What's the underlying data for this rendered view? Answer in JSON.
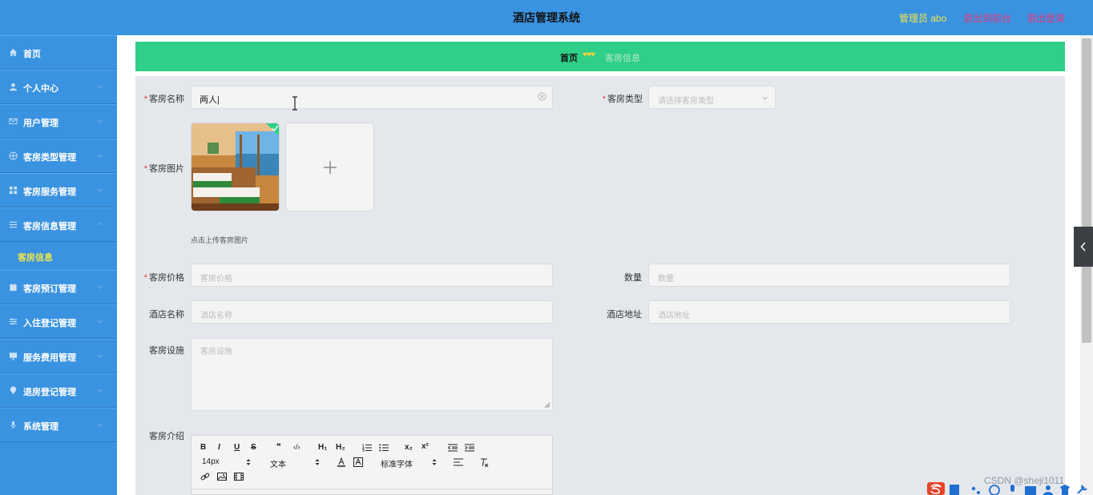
{
  "header": {
    "title": "酒店管理系统",
    "admin": "管理员 abo",
    "front_link": "退出到前台",
    "logout_link": "退出登录"
  },
  "sidebar": {
    "items": [
      {
        "label": "首页",
        "icon": "home-icon"
      },
      {
        "label": "个人中心",
        "icon": "user-icon"
      },
      {
        "label": "用户管理",
        "icon": "mail-icon"
      },
      {
        "label": "客房类型管理",
        "icon": "globe-icon"
      },
      {
        "label": "客房服务管理",
        "icon": "grid-icon"
      },
      {
        "label": "客房信息管理",
        "icon": "menu-icon"
      },
      {
        "label": "客房预订管理",
        "icon": "calendar-icon"
      },
      {
        "label": "入住登记管理",
        "icon": "sliders-icon"
      },
      {
        "label": "服务费用管理",
        "icon": "monitor-icon"
      },
      {
        "label": "退房登记管理",
        "icon": "pin-icon"
      },
      {
        "label": "系统管理",
        "icon": "mic-icon"
      }
    ],
    "active_sub": "客房信息"
  },
  "breadcrumb": {
    "home": "首页",
    "hearts": "♥♥♥",
    "current": "客房信息"
  },
  "form": {
    "room_name": {
      "label": "客房名称",
      "value": "两人|"
    },
    "room_type": {
      "label": "客房类型",
      "placeholder": "请选择客房类型"
    },
    "room_image": {
      "label": "客房图片",
      "hint": "点击上传客房图片"
    },
    "room_price": {
      "label": "客房价格",
      "placeholder": "客房价格"
    },
    "quantity": {
      "label": "数量",
      "placeholder": "数量"
    },
    "hotel_name": {
      "label": "酒店名称",
      "placeholder": "酒店名称"
    },
    "hotel_address": {
      "label": "酒店地址",
      "placeholder": "酒店地址"
    },
    "facilities": {
      "label": "客房设施",
      "placeholder": "客房设施"
    },
    "intro": {
      "label": "客房介绍"
    }
  },
  "editor": {
    "bold": "B",
    "italic": "I",
    "underline": "U",
    "strike": "S",
    "quote": "❞",
    "code": "‹/›",
    "h1": "H₁",
    "h2": "H₂",
    "sub": "x₂",
    "sup": "x²",
    "font_size": "14px",
    "text_style": "文本",
    "font_family": "标准字体"
  },
  "watermark": "CSDN @sheji1011"
}
